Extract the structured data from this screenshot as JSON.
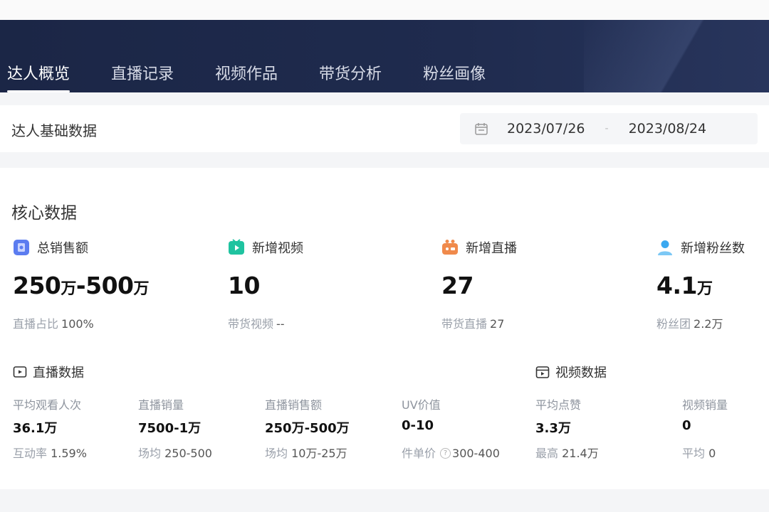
{
  "nav": {
    "tabs": [
      {
        "label": "达人概览",
        "active": true
      },
      {
        "label": "直播记录",
        "active": false
      },
      {
        "label": "视频作品",
        "active": false
      },
      {
        "label": "带货分析",
        "active": false
      },
      {
        "label": "粉丝画像",
        "active": false
      }
    ]
  },
  "base": {
    "title": "达人基础数据",
    "date_start": "2023/07/26",
    "date_separator": "-",
    "date_end": "2023/08/24"
  },
  "core": {
    "title": "核心数据",
    "metrics": [
      {
        "label": "总销售额",
        "icon": "sales-icon",
        "value_a": "250",
        "unit_a": "万",
        "value_sep": "-500",
        "unit_b": "万",
        "sub_label": "直播占比",
        "sub_value": "100%"
      },
      {
        "label": "新增视频",
        "icon": "video-icon",
        "value": "10",
        "sub_label": "带货视频",
        "sub_value": "--"
      },
      {
        "label": "新增直播",
        "icon": "live-icon",
        "value": "27",
        "sub_label": "带货直播",
        "sub_value": "27"
      },
      {
        "label": "新增粉丝数",
        "icon": "fans-icon",
        "value": "4.1",
        "unit": "万",
        "sub_label": "粉丝团",
        "sub_value": "2.2万"
      }
    ],
    "live_section": {
      "title": "直播数据",
      "stats": [
        {
          "label": "平均观看人次",
          "value": "36.1万",
          "sub_label": "互动率",
          "sub_value": "1.59%"
        },
        {
          "label": "直播销量",
          "value": "7500-1万",
          "sub_label": "场均",
          "sub_value": "250-500"
        },
        {
          "label": "直播销售额",
          "value": "250万-500万",
          "sub_label": "场均",
          "sub_value": "10万-25万"
        },
        {
          "label": "UV价值",
          "value": "0-10",
          "sub_label": "件单价",
          "sub_value": "300-400"
        }
      ]
    },
    "video_section": {
      "title": "视频数据",
      "stats": [
        {
          "label": "平均点赞",
          "value": "3.3万",
          "sub_label": "最高",
          "sub_value": "21.4万"
        },
        {
          "label": "视频销量",
          "value": "0",
          "sub_label": "平均",
          "sub_value": "0"
        }
      ]
    }
  },
  "colors": {
    "nav_bg": "#1f2b4e",
    "sales_icon": "#5b7cf0",
    "video_icon": "#1fc3a0",
    "live_icon": "#f08a4b",
    "fans_icon": "#3aa8f0"
  }
}
